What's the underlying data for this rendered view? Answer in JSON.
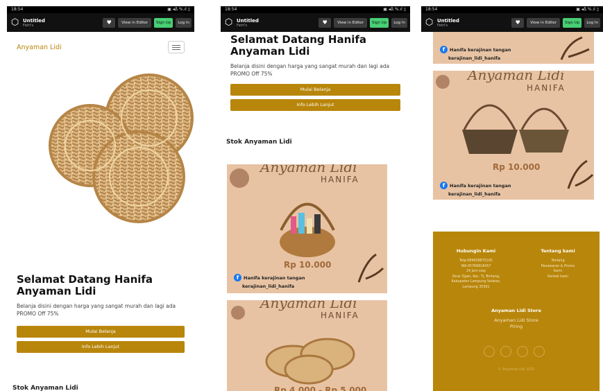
{
  "status": {
    "time": "18:54",
    "icons": "▣ ◂ᐃ %.ıl ▯"
  },
  "codepen": {
    "title": "Untitled",
    "subtitle": "Fetri's",
    "editor_label": "View in Editor",
    "signup_label": "Sign Up",
    "login_label": "Log In"
  },
  "site": {
    "brand": "Anyaman Lidi",
    "welcome_line1": "Selamat Datang Hanifa",
    "welcome_line2": "Anyaman Lidi",
    "description": "Belanja disini dengan harga yang sangat murah dan lagi ada PROMO Off 75%",
    "cta_primary": "Mulai Belanja",
    "cta_secondary": "Info Lebih Lanjut",
    "stock_title": "Stok Anyaman Lidi"
  },
  "products": [
    {
      "brand_script": "Anyaman Lidi",
      "hanifa": "HANIFA",
      "price": "Rp 10.000",
      "fb": "Hanifa kerajinan tangan",
      "ig": "kerajinan_lidi_hanifa"
    },
    {
      "brand_script": "Anyaman Lidi",
      "hanifa": "HANIFA",
      "price": "Rp 4.000 - Rp 5.000",
      "fb": "",
      "ig": ""
    },
    {
      "brand_script": "Anyaman Lidi",
      "hanifa": "HANIFA",
      "price": "Rp 10.000",
      "fb": "Hanifa kerajinan tangan",
      "ig": "kerajinan_lidi_hanifa"
    }
  ],
  "footer": {
    "contact_title": "Hubungin Kami",
    "contact_lines": [
      "Telp:089658875105",
      "WA:05766818457",
      "24 Jam siap",
      "Sinar Ogan, Kec. Tj. Bintang,",
      "Kabupaten Lampung Selatan,",
      "Lampung 35361"
    ],
    "about_title": "Tentang kami",
    "about_lines": [
      "Tentang",
      "Penawaran & Promo",
      "Kami",
      "Kontak kami"
    ],
    "store_title": "Anyaman Lidi Store",
    "store_lines": [
      "Anyaman Lidi Store",
      "Piring"
    ],
    "copyright": "© Anyaman Lidi 2021"
  },
  "colors": {
    "accent": "#b8860b",
    "card_bg": "#e8c3a3",
    "appbar": "#111111",
    "signup": "#47cf73"
  }
}
